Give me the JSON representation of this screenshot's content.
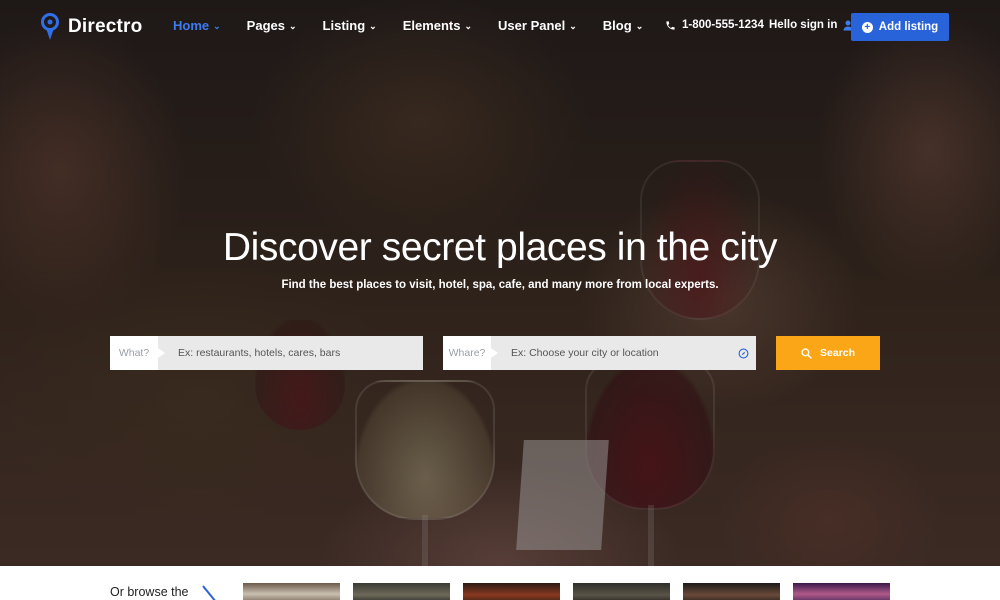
{
  "brand": {
    "name": "Directro",
    "accent": "#2963d9",
    "active_link": "#3c7bf0"
  },
  "nav": {
    "items": [
      {
        "label": "Home",
        "active": true
      },
      {
        "label": "Pages",
        "active": false
      },
      {
        "label": "Listing",
        "active": false
      },
      {
        "label": "Elements",
        "active": false
      },
      {
        "label": "User Panel",
        "active": false
      },
      {
        "label": "Blog",
        "active": false
      }
    ],
    "chevron": "chevron-down-icon",
    "phone": "1-800-555-1234",
    "signin": "Hello sign in",
    "add_listing": "Add listing"
  },
  "hero": {
    "title": "Discover secret places in the city",
    "subtitle": "Find the best places to visit, hotel, spa, cafe, and many more from local experts."
  },
  "search": {
    "what_label": "What?",
    "what_placeholder": "Ex: restaurants, hotels, cares, bars",
    "where_label": "Whare?",
    "where_placeholder": "Ex: Choose your city or location",
    "button": "Search",
    "button_color": "#fba616"
  },
  "browse": {
    "label": "Or browse the"
  }
}
